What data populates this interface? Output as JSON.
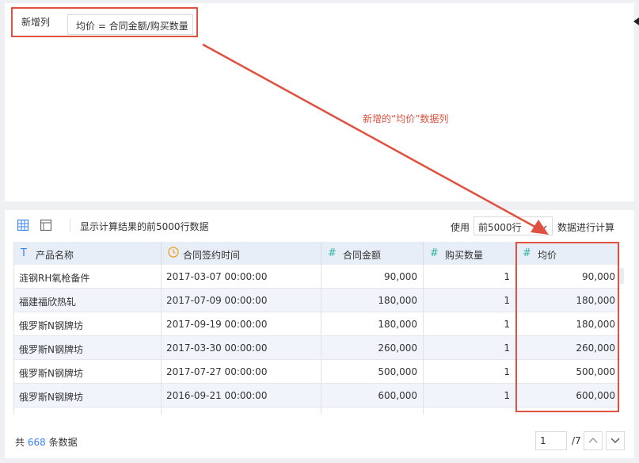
{
  "formula": {
    "label": "新增列",
    "expression": "均价 = 合同金额/购买数量"
  },
  "annotation": {
    "text": "新增的“均价”数据列",
    "color": "#e0513f"
  },
  "toolbar": {
    "grid_icon": "table-grid-icon",
    "layout_icon": "layout-panel-icon",
    "preview_text": "显示计算结果的前5000行数据",
    "use_label": "使用",
    "rows_selected": "前5000行",
    "calc_label": "数据进行计算"
  },
  "table": {
    "columns": [
      {
        "label": "产品名称",
        "type": "text",
        "icon": "T"
      },
      {
        "label": "合同签约时间",
        "type": "date",
        "icon": "clock-icon"
      },
      {
        "label": "合同金额",
        "type": "number",
        "icon": "#"
      },
      {
        "label": "购买数量",
        "type": "number",
        "icon": "#"
      },
      {
        "label": "均价",
        "type": "number",
        "icon": "#"
      }
    ],
    "rows": [
      [
        "涟钢RH氧枪备件",
        "2017-03-07 00:00:00",
        "90,000",
        "1",
        "90,000"
      ],
      [
        "福建福欣热轧",
        "2017-07-09 00:00:00",
        "180,000",
        "1",
        "180,000"
      ],
      [
        "俄罗斯N钢牌坊",
        "2017-09-19 00:00:00",
        "180,000",
        "1",
        "180,000"
      ],
      [
        "俄罗斯N钢牌坊",
        "2017-03-30 00:00:00",
        "260,000",
        "1",
        "260,000"
      ],
      [
        "俄罗斯N钢牌坊",
        "2017-07-27 00:00:00",
        "500,000",
        "1",
        "500,000"
      ],
      [
        "俄罗斯N钢牌坊",
        "2016-09-21 00:00:00",
        "600,000",
        "1",
        "600,000"
      ]
    ]
  },
  "footer": {
    "prefix": "共",
    "count": "668",
    "suffix": "条数据",
    "page_value": "1",
    "page_total": "/7"
  },
  "colors": {
    "accent": "#3b82f6",
    "highlight": "#e0513f",
    "number_icon": "#2fb5a5",
    "date_icon": "#f0a020",
    "header_bg": "#e8eef8"
  }
}
